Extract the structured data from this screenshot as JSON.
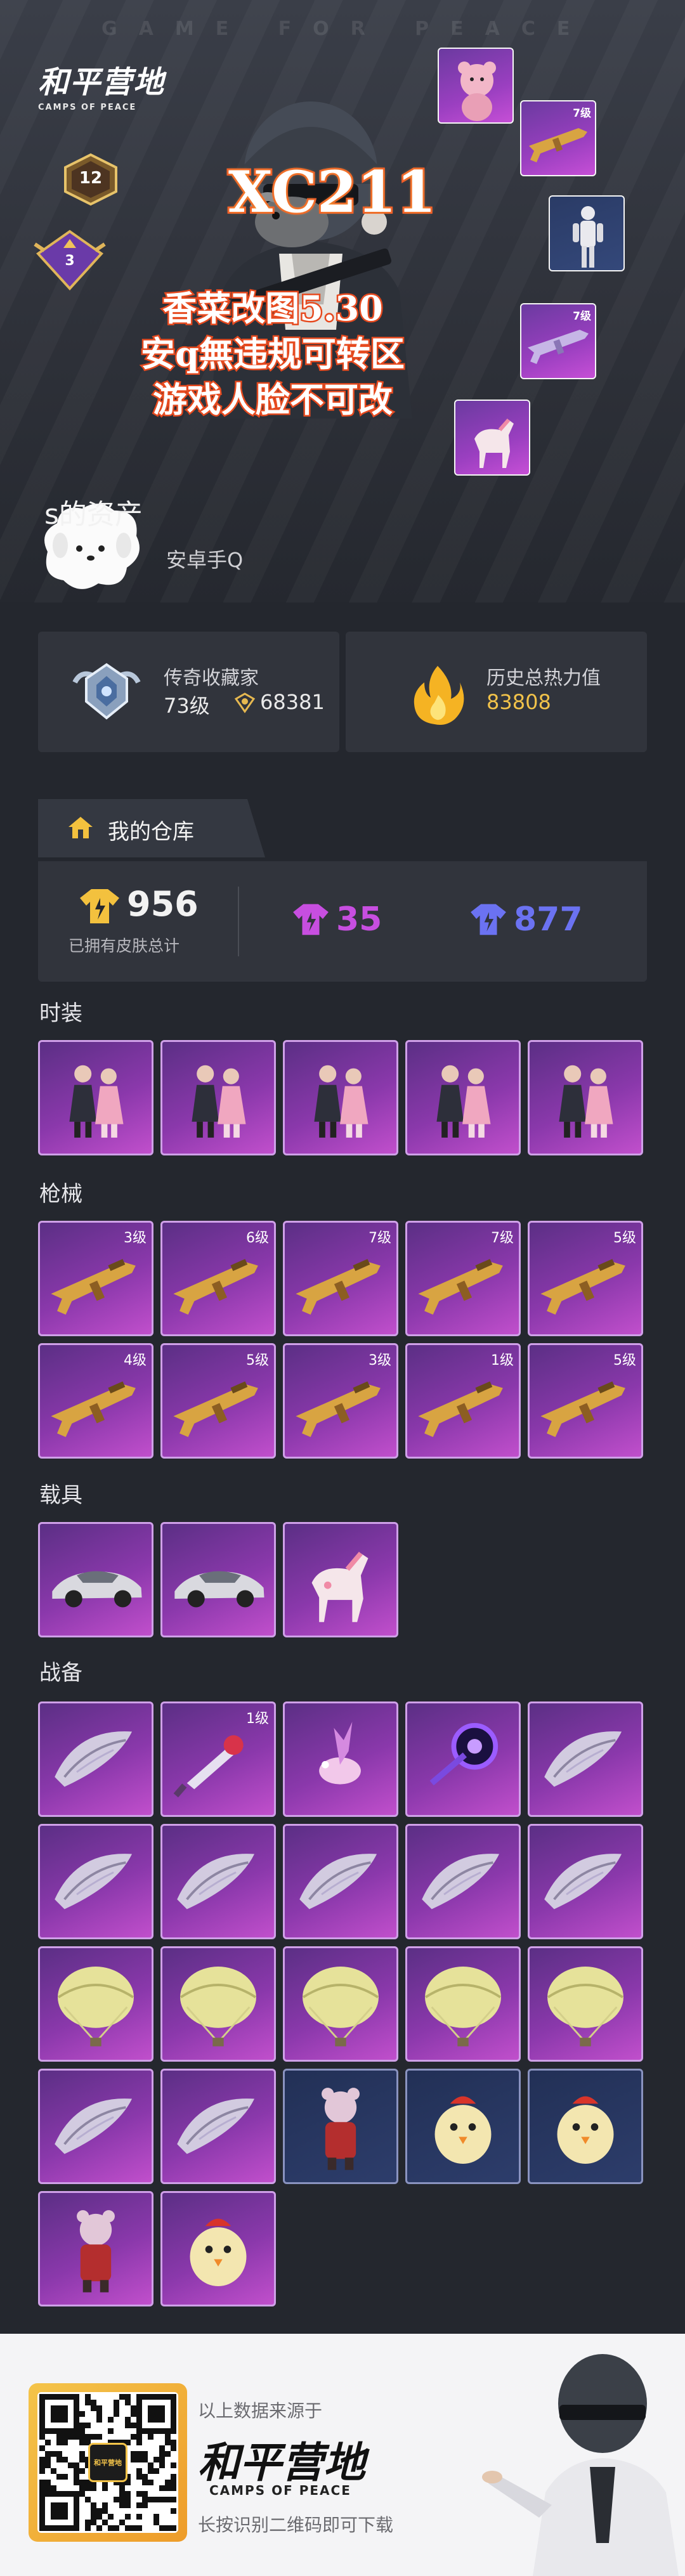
{
  "hero": {
    "watermark": "GAME FOR PEACE",
    "logo_cn": "和平营地",
    "logo_en": "CAMPS OF PEACE",
    "rank_badge": "12",
    "tier_badge": "3",
    "title": "XC211",
    "overlay_lines": [
      "香菜改图5.30",
      "安q無违规可转区",
      "游戏人脸不可改"
    ],
    "name": "s的资产",
    "server": "安卓手Q",
    "tiles": [
      {
        "kind": "bear",
        "level": ""
      },
      {
        "kind": "gun",
        "level": "7级"
      },
      {
        "kind": "figure",
        "level": ""
      },
      {
        "kind": "gun",
        "level": "7级"
      },
      {
        "kind": "horse",
        "level": ""
      }
    ]
  },
  "stats": {
    "collector_label": "传奇收藏家",
    "collector_level": "73级",
    "collector_points": "68381",
    "heat_label": "历史总热力值",
    "heat_value": "83808"
  },
  "warehouse": {
    "title": "我的仓库",
    "total": "956",
    "total_label": "已拥有皮肤总计",
    "pink_count": "35",
    "purple_count": "877"
  },
  "sections": {
    "fashion": {
      "label": "时装",
      "items": [
        {
          "kind": "outfit",
          "level": ""
        },
        {
          "kind": "outfit",
          "level": ""
        },
        {
          "kind": "outfit",
          "level": ""
        },
        {
          "kind": "outfit",
          "level": ""
        },
        {
          "kind": "outfit",
          "level": ""
        }
      ]
    },
    "guns": {
      "label": "枪械",
      "items": [
        {
          "kind": "gun",
          "level": "3级"
        },
        {
          "kind": "gun",
          "level": "6级"
        },
        {
          "kind": "gun",
          "level": "7级"
        },
        {
          "kind": "gun",
          "level": "7级"
        },
        {
          "kind": "gun",
          "level": "5级"
        },
        {
          "kind": "gun",
          "level": "4级"
        },
        {
          "kind": "gun",
          "level": "5级"
        },
        {
          "kind": "gun",
          "level": "3级"
        },
        {
          "kind": "gun",
          "level": "1级"
        },
        {
          "kind": "gun",
          "level": "5级"
        }
      ]
    },
    "vehicles": {
      "label": "载具",
      "items": [
        {
          "kind": "car",
          "level": ""
        },
        {
          "kind": "car",
          "level": ""
        },
        {
          "kind": "horse",
          "level": ""
        }
      ]
    },
    "gear": {
      "label": "战备",
      "items": [
        {
          "kind": "glider",
          "level": ""
        },
        {
          "kind": "knife",
          "level": "1级"
        },
        {
          "kind": "flower",
          "level": ""
        },
        {
          "kind": "orb",
          "level": ""
        },
        {
          "kind": "glider",
          "level": ""
        },
        {
          "kind": "glider",
          "level": ""
        },
        {
          "kind": "glider",
          "level": ""
        },
        {
          "kind": "glider",
          "level": ""
        },
        {
          "kind": "glider",
          "level": ""
        },
        {
          "kind": "glider",
          "level": ""
        },
        {
          "kind": "parachute",
          "level": ""
        },
        {
          "kind": "parachute",
          "level": ""
        },
        {
          "kind": "parachute",
          "level": ""
        },
        {
          "kind": "parachute",
          "level": ""
        },
        {
          "kind": "parachute",
          "level": ""
        },
        {
          "kind": "glider",
          "level": ""
        },
        {
          "kind": "glider",
          "level": ""
        },
        {
          "kind": "mascot",
          "level": ""
        },
        {
          "kind": "chick",
          "level": ""
        },
        {
          "kind": "chick",
          "level": ""
        },
        {
          "kind": "mascot",
          "level": ""
        },
        {
          "kind": "chick",
          "level": ""
        }
      ]
    }
  },
  "footer": {
    "source": "以上数据来源于",
    "logo_cn": "和平营地",
    "logo_en": "CAMPS OF PEACE",
    "tip": "长按识别二维码即可下载",
    "qr_label": "和平营地"
  },
  "colors": {
    "pink": "#c74ee0",
    "purple": "#6b72f2",
    "gold": "#f1c24a",
    "accent_orange": "#e64a1f"
  }
}
